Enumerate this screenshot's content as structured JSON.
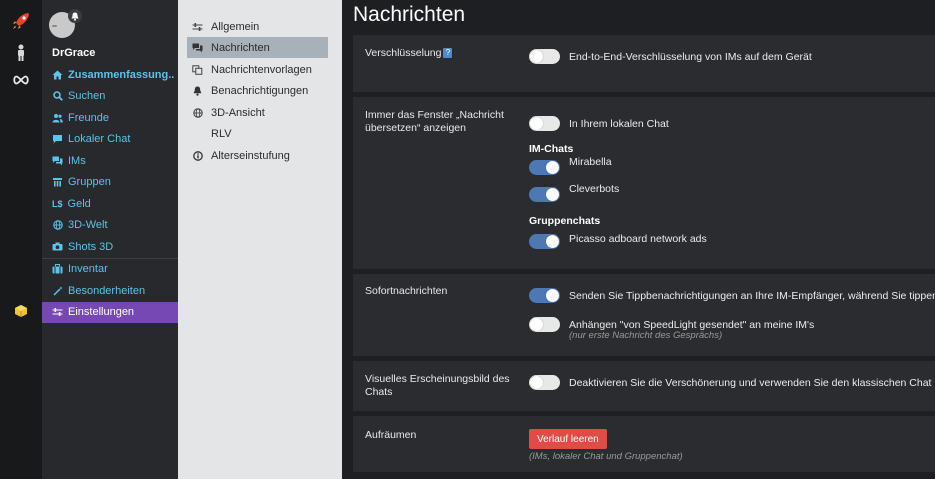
{
  "user": {
    "name": "DrGrace"
  },
  "sidebar": {
    "items": [
      {
        "label": "Zusammenfassung..",
        "icon": "home-icon"
      },
      {
        "label": "Suchen",
        "icon": "search-icon"
      },
      {
        "label": "Freunde",
        "icon": "users-icon"
      },
      {
        "label": "Lokaler Chat",
        "icon": "chat-icon"
      },
      {
        "label": "IMs",
        "icon": "comments-icon"
      },
      {
        "label": "Gruppen",
        "icon": "group-icon"
      },
      {
        "label": "Geld",
        "icon": "money-icon",
        "prefix": "L$"
      },
      {
        "label": "3D-Welt",
        "icon": "globe-icon"
      },
      {
        "label": "Shots 3D",
        "icon": "camera-icon"
      },
      {
        "label": "Inventar",
        "icon": "suitcase-icon"
      },
      {
        "label": "Besonderheiten",
        "icon": "magic-wand-icon"
      },
      {
        "label": "Einstellungen",
        "icon": "sliders-icon"
      }
    ]
  },
  "subnav": {
    "items": [
      {
        "label": "Allgemein",
        "icon": "sliders-icon"
      },
      {
        "label": "Nachrichten",
        "icon": "comments-icon"
      },
      {
        "label": "Nachrichtenvorlagen",
        "icon": "copy-icon"
      },
      {
        "label": "Benachrichtigungen",
        "icon": "bell-icon"
      },
      {
        "label": "3D-Ansicht",
        "icon": "globe-icon"
      },
      {
        "label": "RLV",
        "icon": ""
      },
      {
        "label": "Alterseinstufung",
        "icon": "info-icon"
      }
    ]
  },
  "main": {
    "title": "Nachrichten",
    "encryption": {
      "label": "Verschlüsselung",
      "help": "?",
      "toggle_label": "End-to-End-Verschlüsselung von IMs auf dem Gerät",
      "on": false
    },
    "translate": {
      "label_line1": "Immer das Fenster „Nachricht",
      "label_line2": "übersetzen“ anzeigen",
      "local_chat": {
        "label": "In Ihrem lokalen Chat",
        "on": false
      },
      "im_heading": "IM-Chats",
      "im_items": [
        {
          "label": "Mirabella",
          "on": true
        },
        {
          "label": "Cleverbots",
          "on": true
        }
      ],
      "group_heading": "Gruppenchats",
      "group_items": [
        {
          "label": "Picasso adboard network ads",
          "on": true
        }
      ]
    },
    "instant": {
      "label": "Sofortnachrichten",
      "typing": {
        "label": "Senden Sie Tippbenachrichtigungen an Ihre IM-Empfänger, während Sie tippen",
        "on": true
      },
      "append": {
        "label": "Anhängen \"von SpeedLight gesendet\" an meine IM's",
        "on": false,
        "note": "(nur erste Nachricht des Gesprächs)"
      }
    },
    "visual": {
      "label_line1": "Visuelles Erscheinungsbild des",
      "label_line2": "Chats",
      "toggle_label": "Deaktivieren Sie die Verschönerung und verwenden Sie den klassischen Chat",
      "on": false
    },
    "cleanup": {
      "label": "Aufräumen",
      "button": "Verlauf leeren",
      "note": "(IMs, lokaler Chat und Gruppenchat)"
    }
  },
  "colors": {
    "accent": "#7548b4",
    "link": "#5dc3e8",
    "toggle_on": "#4c79b4",
    "danger": "#e04b45"
  }
}
